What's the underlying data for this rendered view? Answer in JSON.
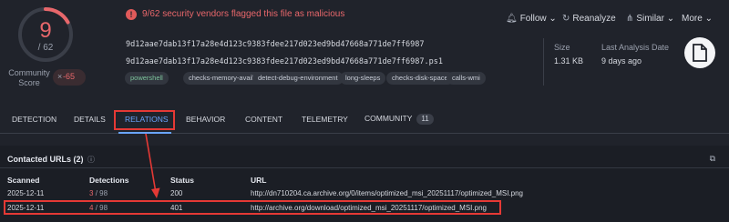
{
  "score": {
    "detected": "9",
    "total": "/ 62"
  },
  "community": {
    "label": "Community Score",
    "close": "×",
    "value": "-65"
  },
  "banner": {
    "text": "9/62 security vendors flagged this file as malicious",
    "icon": "warning-icon"
  },
  "actions": [
    {
      "label": "Follow",
      "icon": "bell-icon",
      "chevron": true
    },
    {
      "label": "Reanalyze",
      "icon": "refresh-icon",
      "chevron": false
    },
    {
      "label": "Similar",
      "icon": "similar-icon",
      "chevron": true
    },
    {
      "label": "More",
      "icon": "",
      "chevron": true
    }
  ],
  "file": {
    "hash": "9d12aae7dab13f17a28e4d123c9383fdee217d023ed9bd47668a771de7ff6987",
    "name": "9d12aae7dab13f17a28e4d123c9383fdee217d023ed9bd47668a771de7ff6987.ps1",
    "tags": [
      "powershell",
      "checks-memory-available",
      "detect-debug-environment",
      "long-sleeps",
      "checks-disk-space",
      "calls-wmi"
    ],
    "size_label": "Size",
    "size_value": "1.31 KB",
    "date_label": "Last Analysis Date",
    "date_value": "9 days ago"
  },
  "tabs": [
    {
      "label": "DETECTION",
      "active": false
    },
    {
      "label": "DETAILS",
      "active": false
    },
    {
      "label": "RELATIONS",
      "active": true
    },
    {
      "label": "BEHAVIOR",
      "active": false
    },
    {
      "label": "CONTENT",
      "active": false
    },
    {
      "label": "TELEMETRY",
      "active": false
    },
    {
      "label": "COMMUNITY",
      "active": false,
      "badge": "11"
    }
  ],
  "contacted": {
    "title": "Contacted URLs",
    "count": "(2)",
    "columns": [
      "Scanned",
      "Detections",
      "Status",
      "URL"
    ],
    "rows": [
      {
        "scanned": "2025-12-11",
        "det_hit": "3",
        "det_total": "/ 98",
        "status": "200",
        "url": "http://dn710204.ca.archive.org/0/items/optimized_msi_20251117/optimized_MSI.png"
      },
      {
        "scanned": "2025-12-11",
        "det_hit": "4",
        "det_total": "/ 98",
        "status": "401",
        "url": "http://archive.org/download/optimized_msi_20251117/optimized_MSI.png"
      }
    ]
  },
  "colors": {
    "accent": "#6aa5ff",
    "malicious": "#e8676b",
    "annotation": "#e53935"
  }
}
